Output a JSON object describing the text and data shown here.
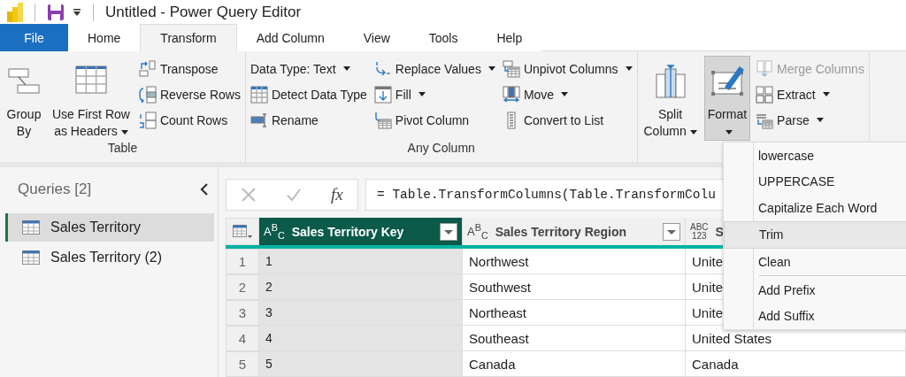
{
  "window": {
    "title": "Untitled - Power Query Editor"
  },
  "tabs": [
    {
      "label": "File",
      "kind": "file",
      "selected": false
    },
    {
      "label": "Home",
      "kind": "tab",
      "selected": false
    },
    {
      "label": "Transform",
      "kind": "tab",
      "selected": true
    },
    {
      "label": "Add Column",
      "kind": "tab",
      "selected": false
    },
    {
      "label": "View",
      "kind": "tab",
      "selected": false
    },
    {
      "label": "Tools",
      "kind": "tab",
      "selected": false
    },
    {
      "label": "Help",
      "kind": "tab",
      "selected": false
    }
  ],
  "ribbon": {
    "groups": [
      {
        "label": "Table",
        "large": [
          {
            "label": "Group\nBy",
            "dropdown": false,
            "pressed": false
          },
          {
            "label": "Use First Row\nas Headers",
            "dropdown": true,
            "pressed": false
          }
        ],
        "columns": [
          [
            {
              "label": "Transpose",
              "dropdown": false,
              "disabled": false
            },
            {
              "label": "Reverse Rows",
              "dropdown": false,
              "disabled": false
            },
            {
              "label": "Count Rows",
              "dropdown": false,
              "disabled": false
            }
          ]
        ]
      },
      {
        "label": "Any Column",
        "columns": [
          [
            {
              "label": "Data Type: Text",
              "dropdown": true,
              "disabled": false
            },
            {
              "label": "Detect Data Type",
              "dropdown": false,
              "disabled": false
            },
            {
              "label": "Rename",
              "dropdown": false,
              "disabled": false
            }
          ],
          [
            {
              "label": "Replace Values",
              "dropdown": true,
              "disabled": false
            },
            {
              "label": "Fill",
              "dropdown": true,
              "disabled": false
            },
            {
              "label": "Pivot Column",
              "dropdown": false,
              "disabled": false
            }
          ],
          [
            {
              "label": "Unpivot Columns",
              "dropdown": true,
              "disabled": false
            },
            {
              "label": "Move",
              "dropdown": true,
              "disabled": false
            },
            {
              "label": "Convert to List",
              "dropdown": false,
              "disabled": false
            }
          ]
        ]
      },
      {
        "large": [
          {
            "label": "Split\nColumn",
            "dropdown": true,
            "pressed": false
          },
          {
            "label": "Format\n",
            "dropdown": true,
            "pressed": true
          }
        ],
        "columns": [
          [
            {
              "label": "Merge Columns",
              "dropdown": false,
              "disabled": true
            },
            {
              "label": "Extract",
              "dropdown": true,
              "disabled": false
            },
            {
              "label": "Parse",
              "dropdown": true,
              "disabled": false
            }
          ]
        ]
      }
    ]
  },
  "queries": {
    "title": "Queries [2]",
    "items": [
      {
        "label": "Sales Territory",
        "selected": true
      },
      {
        "label": "Sales Territory (2)",
        "selected": false
      }
    ]
  },
  "formula_bar": {
    "fx": "fx",
    "formula": "= Table.TransformColumns(Table.TransformColu"
  },
  "table": {
    "columns": [
      {
        "name": "Sales Territory Key",
        "type": "A$^{B}$$_{C}$",
        "selected": true
      },
      {
        "name": "Sales Territory Region",
        "type": "A$^{B}$$_{C}$",
        "selected": false
      },
      {
        "name": "S",
        "type": "ABC\n123",
        "selected": false
      }
    ],
    "rows": [
      {
        "number": "1",
        "cells": [
          "1",
          "Northwest",
          "Unite"
        ]
      },
      {
        "number": "2",
        "cells": [
          "2",
          "Southwest",
          "Unite"
        ]
      },
      {
        "number": "3",
        "cells": [
          "3",
          "Northeast",
          "Unite"
        ]
      },
      {
        "number": "4",
        "cells": [
          "4",
          "Southeast",
          "United States"
        ]
      },
      {
        "number": "5",
        "cells": [
          "5",
          "Canada",
          "Canada"
        ]
      }
    ]
  },
  "format_menu": {
    "items": [
      {
        "label": "lowercase",
        "hovered": false,
        "divider_above": false
      },
      {
        "label": "UPPERCASE",
        "hovered": false,
        "divider_above": false
      },
      {
        "label": "Capitalize Each Word",
        "hovered": false,
        "divider_above": false
      },
      {
        "label": "Trim",
        "hovered": true,
        "divider_above": false
      },
      {
        "label": "Clean",
        "hovered": false,
        "divider_above": false
      },
      {
        "label": "Add Prefix",
        "hovered": false,
        "divider_above": true
      },
      {
        "label": "Add Suffix",
        "hovered": false,
        "divider_above": false
      }
    ]
  }
}
